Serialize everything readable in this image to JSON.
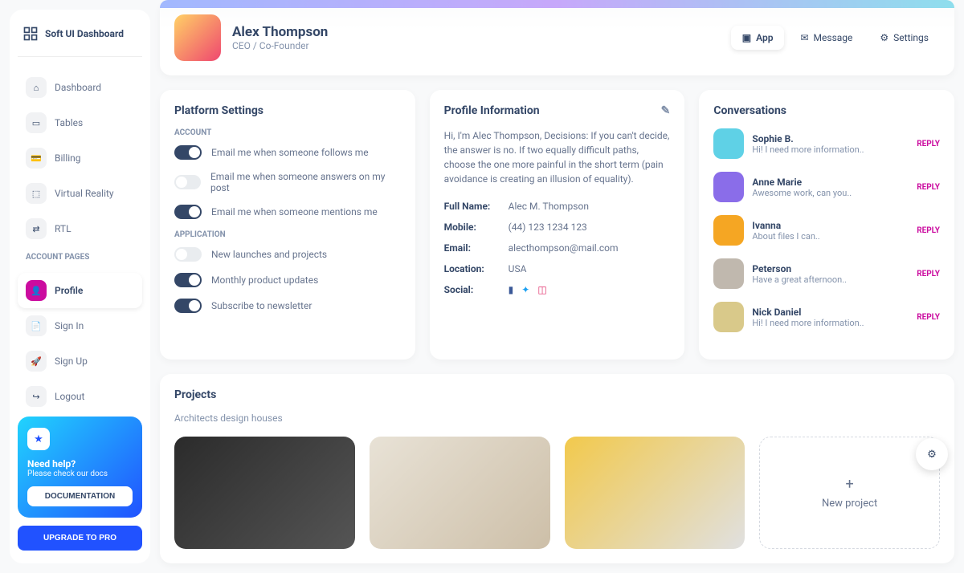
{
  "brand": "Soft UI Dashboard",
  "nav": {
    "items": [
      {
        "label": "Dashboard",
        "icon": "⌂"
      },
      {
        "label": "Tables",
        "icon": "▭"
      },
      {
        "label": "Billing",
        "icon": "💳"
      },
      {
        "label": "Virtual Reality",
        "icon": "⬚"
      },
      {
        "label": "RTL",
        "icon": "⇄"
      }
    ],
    "accountTitle": "Account Pages",
    "accountItems": [
      {
        "label": "Profile",
        "icon": "👤",
        "active": true
      },
      {
        "label": "Sign In",
        "icon": "📄"
      },
      {
        "label": "Sign Up",
        "icon": "🚀"
      },
      {
        "label": "Logout",
        "icon": "↪"
      }
    ]
  },
  "help": {
    "title": "Need help?",
    "sub": "Please check our docs",
    "docBtn": "DOCUMENTATION",
    "upgradeBtn": "UPGRADE TO PRO"
  },
  "header": {
    "name": "Alex Thompson",
    "role": "CEO / Co-Founder",
    "tabs": [
      {
        "label": "App",
        "icon": "▣",
        "active": true
      },
      {
        "label": "Message",
        "icon": "✉"
      },
      {
        "label": "Settings",
        "icon": "⚙"
      }
    ]
  },
  "settings": {
    "title": "Platform Settings",
    "accountLabel": "Account",
    "accountToggles": [
      {
        "label": "Email me when someone follows me",
        "on": true
      },
      {
        "label": "Email me when someone answers on my post",
        "on": false
      },
      {
        "label": "Email me when someone mentions me",
        "on": true
      }
    ],
    "appLabel": "Application",
    "appToggles": [
      {
        "label": "New launches and projects",
        "on": false
      },
      {
        "label": "Monthly product updates",
        "on": true
      },
      {
        "label": "Subscribe to newsletter",
        "on": true
      }
    ]
  },
  "profile": {
    "title": "Profile Information",
    "bio": "Hi, I'm Alec Thompson, Decisions: If you can't decide, the answer is no. If two equally difficult paths, choose the one more painful in the short term (pain avoidance is creating an illusion of equality).",
    "fields": [
      {
        "label": "Full Name:",
        "value": "Alec M. Thompson"
      },
      {
        "label": "Mobile:",
        "value": "(44) 123 1234 123"
      },
      {
        "label": "Email:",
        "value": "alecthompson@mail.com"
      },
      {
        "label": "Location:",
        "value": "USA"
      }
    ],
    "socialLabel": "Social:"
  },
  "conversations": {
    "title": "Conversations",
    "items": [
      {
        "name": "Sophie B.",
        "msg": "Hi! I need more information..",
        "color": "#5fd1e6"
      },
      {
        "name": "Anne Marie",
        "msg": "Awesome work, can you..",
        "color": "#8a6de9"
      },
      {
        "name": "Ivanna",
        "msg": "About files I can..",
        "color": "#f5a623"
      },
      {
        "name": "Peterson",
        "msg": "Have a great afternoon..",
        "color": "#c0b8ae"
      },
      {
        "name": "Nick Daniel",
        "msg": "Hi! I need more information..",
        "color": "#d9c98a"
      }
    ],
    "reply": "REPLY"
  },
  "projects": {
    "title": "Projects",
    "sub": "Architects design houses",
    "newLabel": "New project",
    "imgs": [
      "linear-gradient(135deg,#2b2b2b,#555)",
      "linear-gradient(135deg,#e8e2d6,#cdbfa8)",
      "linear-gradient(135deg,#f2c94c,#e0e0e0)"
    ]
  }
}
